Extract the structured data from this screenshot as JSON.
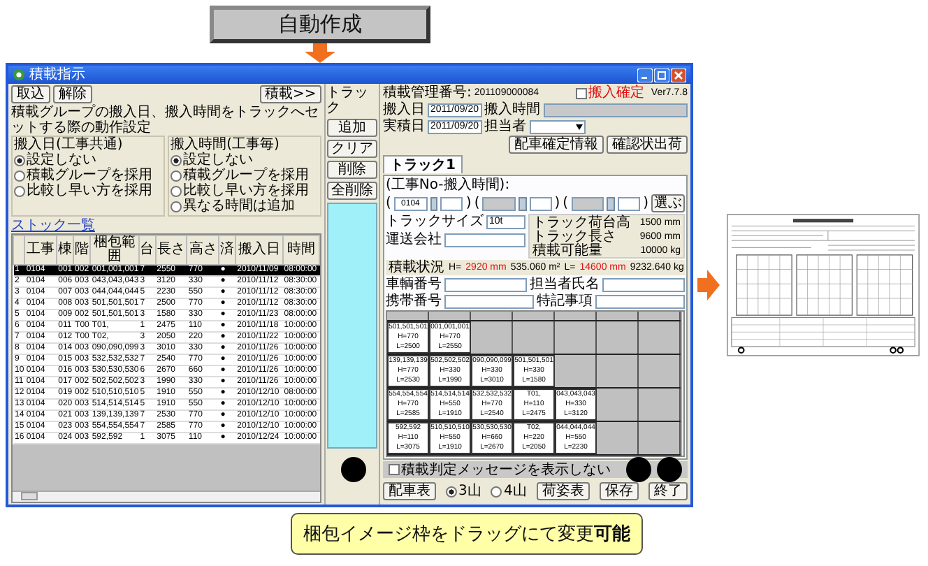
{
  "top_button": {
    "label": "自動作成"
  },
  "dialog": {
    "title": "積載指示",
    "left_pane": {
      "buttons": [
        "取込",
        "解除"
      ],
      "more_button": "積載>>",
      "caption": "積載グループの搬入日、搬入時間をトラックへセットする際の動作設定",
      "groups": [
        {
          "title": "搬入日(工事共通)",
          "options": [
            {
              "label": "設定しない",
              "selected": true
            },
            {
              "label": "積載グループを採用",
              "selected": false
            },
            {
              "label": "比較し早い方を採用",
              "selected": false
            }
          ]
        },
        {
          "title": "搬入時間(工事毎)",
          "options": [
            {
              "label": "設定しない",
              "selected": true
            },
            {
              "label": "積載グループを採用",
              "selected": false
            },
            {
              "label": "比較し早い方を採用",
              "selected": false
            },
            {
              "label": "異なる時間は追加",
              "selected": false
            }
          ]
        }
      ],
      "stock_list": {
        "title": "ストック一覧",
        "columns": [
          "",
          "工事",
          "棟",
          "階",
          "梱包範囲",
          "台",
          "長さ",
          "高さ",
          "済",
          "搬入日",
          "時間"
        ],
        "rows": [
          {
            "cells": [
              "1",
              "0104",
              "001",
              "002",
              "001,001,001",
              "7",
              "2550",
              "770",
              "●",
              "2010/11/09",
              "08:00:00"
            ],
            "selected": true
          },
          {
            "cells": [
              "2",
              "0104",
              "006",
              "003",
              "043,043,043",
              "3",
              "3120",
              "330",
              "●",
              "2010/11/12",
              "08:30:00"
            ],
            "selected": false
          },
          {
            "cells": [
              "3",
              "0104",
              "007",
              "003",
              "044,044,044",
              "5",
              "2230",
              "550",
              "●",
              "2010/11/12",
              "08:30:00"
            ],
            "selected": false
          },
          {
            "cells": [
              "4",
              "0104",
              "008",
              "003",
              "501,501,501",
              "7",
              "2500",
              "770",
              "●",
              "2010/11/12",
              "08:30:00"
            ],
            "selected": false
          },
          {
            "cells": [
              "5",
              "0104",
              "009",
              "002",
              "501,501,501",
              "3",
              "1580",
              "330",
              "●",
              "2010/11/23",
              "08:00:00"
            ],
            "selected": false
          },
          {
            "cells": [
              "6",
              "0104",
              "011",
              "T00",
              "T01,",
              "1",
              "2475",
              "110",
              "●",
              "2010/11/18",
              "10:00:00"
            ],
            "selected": false
          },
          {
            "cells": [
              "7",
              "0104",
              "012",
              "T00",
              "T02,",
              "3",
              "2050",
              "220",
              "●",
              "2010/11/22",
              "10:00:00"
            ],
            "selected": false
          },
          {
            "cells": [
              "8",
              "0104",
              "014",
              "003",
              "090,090,099",
              "3",
              "3010",
              "330",
              "●",
              "2010/11/26",
              "10:00:00"
            ],
            "selected": false
          },
          {
            "cells": [
              "9",
              "0104",
              "015",
              "003",
              "532,532,532",
              "7",
              "2540",
              "770",
              "●",
              "2010/11/26",
              "10:00:00"
            ],
            "selected": false
          },
          {
            "cells": [
              "10",
              "0104",
              "016",
              "003",
              "530,530,530",
              "6",
              "2670",
              "660",
              "●",
              "2010/11/26",
              "10:00:00"
            ],
            "selected": false
          },
          {
            "cells": [
              "11",
              "0104",
              "017",
              "002",
              "502,502,502",
              "3",
              "1990",
              "330",
              "●",
              "2010/11/26",
              "10:00:00"
            ],
            "selected": false
          },
          {
            "cells": [
              "12",
              "0104",
              "019",
              "002",
              "510,510,510",
              "5",
              "1910",
              "550",
              "●",
              "2010/12/10",
              "08:00:00"
            ],
            "selected": false
          },
          {
            "cells": [
              "13",
              "0104",
              "020",
              "003",
              "514,514,514",
              "5",
              "1910",
              "550",
              "●",
              "2010/12/10",
              "10:00:00"
            ],
            "selected": false
          },
          {
            "cells": [
              "14",
              "0104",
              "021",
              "003",
              "139,139,139",
              "7",
              "2530",
              "770",
              "●",
              "2010/12/10",
              "10:00:00"
            ],
            "selected": false
          },
          {
            "cells": [
              "15",
              "0104",
              "023",
              "003",
              "554,554,554",
              "7",
              "2585",
              "770",
              "●",
              "2010/12/10",
              "10:00:00"
            ],
            "selected": false
          },
          {
            "cells": [
              "16",
              "0104",
              "024",
              "003",
              "592,592",
              "1",
              "3075",
              "110",
              "●",
              "2010/12/24",
              "10:00:00"
            ],
            "selected": false
          }
        ]
      }
    },
    "truck_buttons": {
      "title": "トラック",
      "buttons": [
        "追加",
        "クリア",
        "削除",
        "全削除"
      ]
    },
    "right_pane": {
      "management_label": "積載管理番号:",
      "management_number": "201109000084",
      "confirm_checkbox": {
        "label": "搬入確定",
        "checked": false
      },
      "version": "Ver7.7.8",
      "delivery_date": {
        "label": "搬入日",
        "value": "2011/09/20"
      },
      "delivery_time": {
        "label": "搬入時間"
      },
      "actual_date": {
        "label": "実積日",
        "value": "2011/09/20"
      },
      "person": {
        "label": "担当者"
      },
      "action_buttons": [
        "配車確定情報",
        "確認状出荷"
      ],
      "tabs": [
        {
          "label": "トラック1",
          "selected": true
        }
      ],
      "slots_label": "(工事No-搬入時間):",
      "slots": [
        {
          "open": "(",
          "code": "0104",
          "close": ")"
        },
        {
          "open": "(",
          "close": ")"
        },
        {
          "open": "(",
          "close": ")"
        }
      ],
      "pick_button": "選ぶ",
      "truck_size": {
        "label": "トラックサイズ",
        "value": "10t"
      },
      "carrier": {
        "label": "運送会社"
      },
      "truck_info": [
        {
          "label": "トラック荷台高",
          "value": "1500 mm"
        },
        {
          "label": "トラック長さ",
          "value": "9600 mm"
        },
        {
          "label": "積載可能量",
          "value": "10000 kg"
        }
      ],
      "load_status": {
        "label": "積載状況",
        "h_label": "H=",
        "h_value": "2920 mm",
        "area": "535.060 m²",
        "l_label": "L=",
        "l_value": "14600 mm",
        "weight": "9232.640 kg"
      },
      "vehicle_number": {
        "label": "車輌番号"
      },
      "driver_name": {
        "label": "担当者氏名"
      },
      "phone": {
        "label": "携帯番号"
      },
      "notes": {
        "label": "特記事項"
      },
      "packing_grid": {
        "rows": [
          [
            {
              "lines": [
                "501,501,501",
                "H=770",
                "L=2500"
              ]
            },
            {
              "lines": [
                "001,001,001",
                "H=770",
                "L=2550"
              ]
            }
          ],
          [
            {
              "lines": [
                "139,139,139",
                "H=770",
                "L=2530"
              ]
            },
            {
              "lines": [
                "502,502,502",
                "H=330",
                "L=1990"
              ]
            },
            {
              "lines": [
                "090,090,099",
                "H=330",
                "L=3010"
              ]
            },
            {
              "lines": [
                "501,501,501",
                "H=330",
                "L=1580"
              ]
            }
          ],
          [
            {
              "lines": [
                "554,554,554",
                "H=770",
                "L=2585"
              ]
            },
            {
              "lines": [
                "514,514,514",
                "H=550",
                "L=1910"
              ]
            },
            {
              "lines": [
                "532,532,532",
                "H=770",
                "L=2540"
              ]
            },
            {
              "lines": [
                "T01,",
                "H=110",
                "L=2475"
              ]
            },
            {
              "lines": [
                "043,043,043",
                "H=330",
                "L=3120"
              ]
            }
          ],
          [
            {
              "lines": [
                "592,592",
                "H=110",
                "L=3075"
              ]
            },
            {
              "lines": [
                "510,510,510",
                "H=550",
                "L=1910"
              ]
            },
            {
              "lines": [
                "530,530,530",
                "H=660",
                "L=2670"
              ]
            },
            {
              "lines": [
                "T02,",
                "H=220",
                "L=2050"
              ]
            },
            {
              "lines": [
                "044,044,044",
                "H=550",
                "L=2230"
              ]
            }
          ]
        ]
      },
      "message_checkbox": {
        "label": "積載判定メッセージを表示しない",
        "checked": false
      },
      "bottom_buttons": {
        "left": "配車表",
        "radios": [
          {
            "label": "3山",
            "selected": true
          },
          {
            "label": "4山",
            "selected": false
          }
        ],
        "right": [
          "荷姿表",
          "保存",
          "終了"
        ]
      }
    }
  },
  "note": "梱包イメージ枠をドラッグにて変更**可能**"
}
